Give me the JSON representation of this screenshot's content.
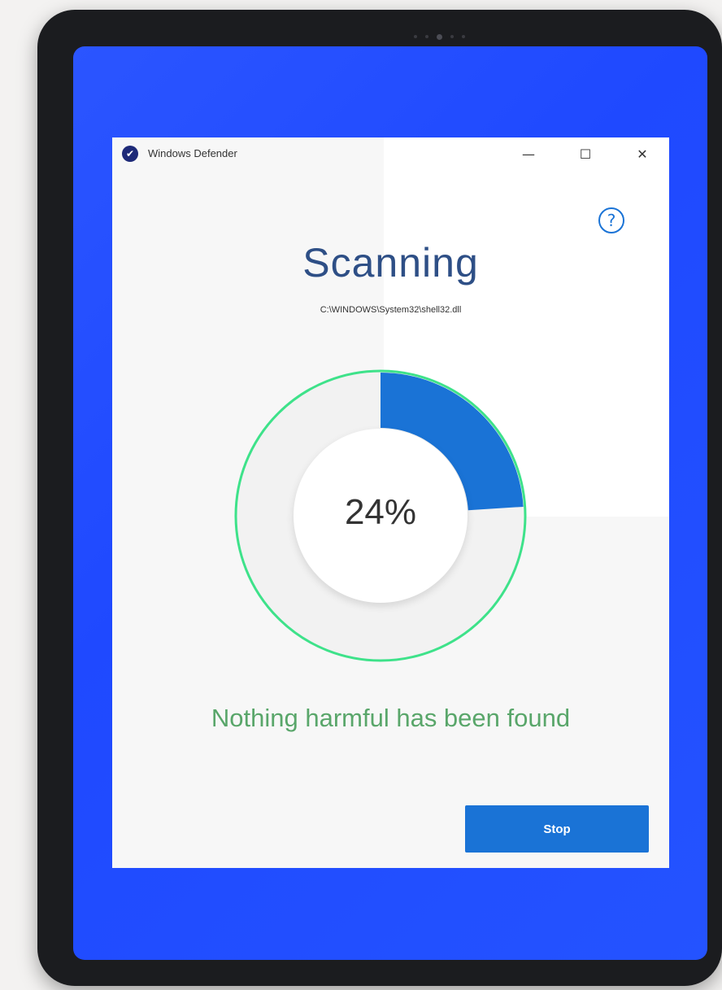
{
  "window": {
    "title": "Windows Defender",
    "minimize_icon": "minimize-icon",
    "maximize_icon": "maximize-icon",
    "close_icon": "close-icon",
    "help_icon": "help-icon"
  },
  "scan": {
    "heading": "Scanning",
    "current_file": "C:\\WINDOWS\\System32\\shell32.dll",
    "progress_percent": 24,
    "progress_label": "24%",
    "status": "Nothing harmful has been found",
    "stop_label": "Stop"
  },
  "colors": {
    "accent": "#1a73d6",
    "ring_outline": "#3ee28a",
    "status_text": "#59a66a",
    "screen_bg": "#2453ff"
  }
}
